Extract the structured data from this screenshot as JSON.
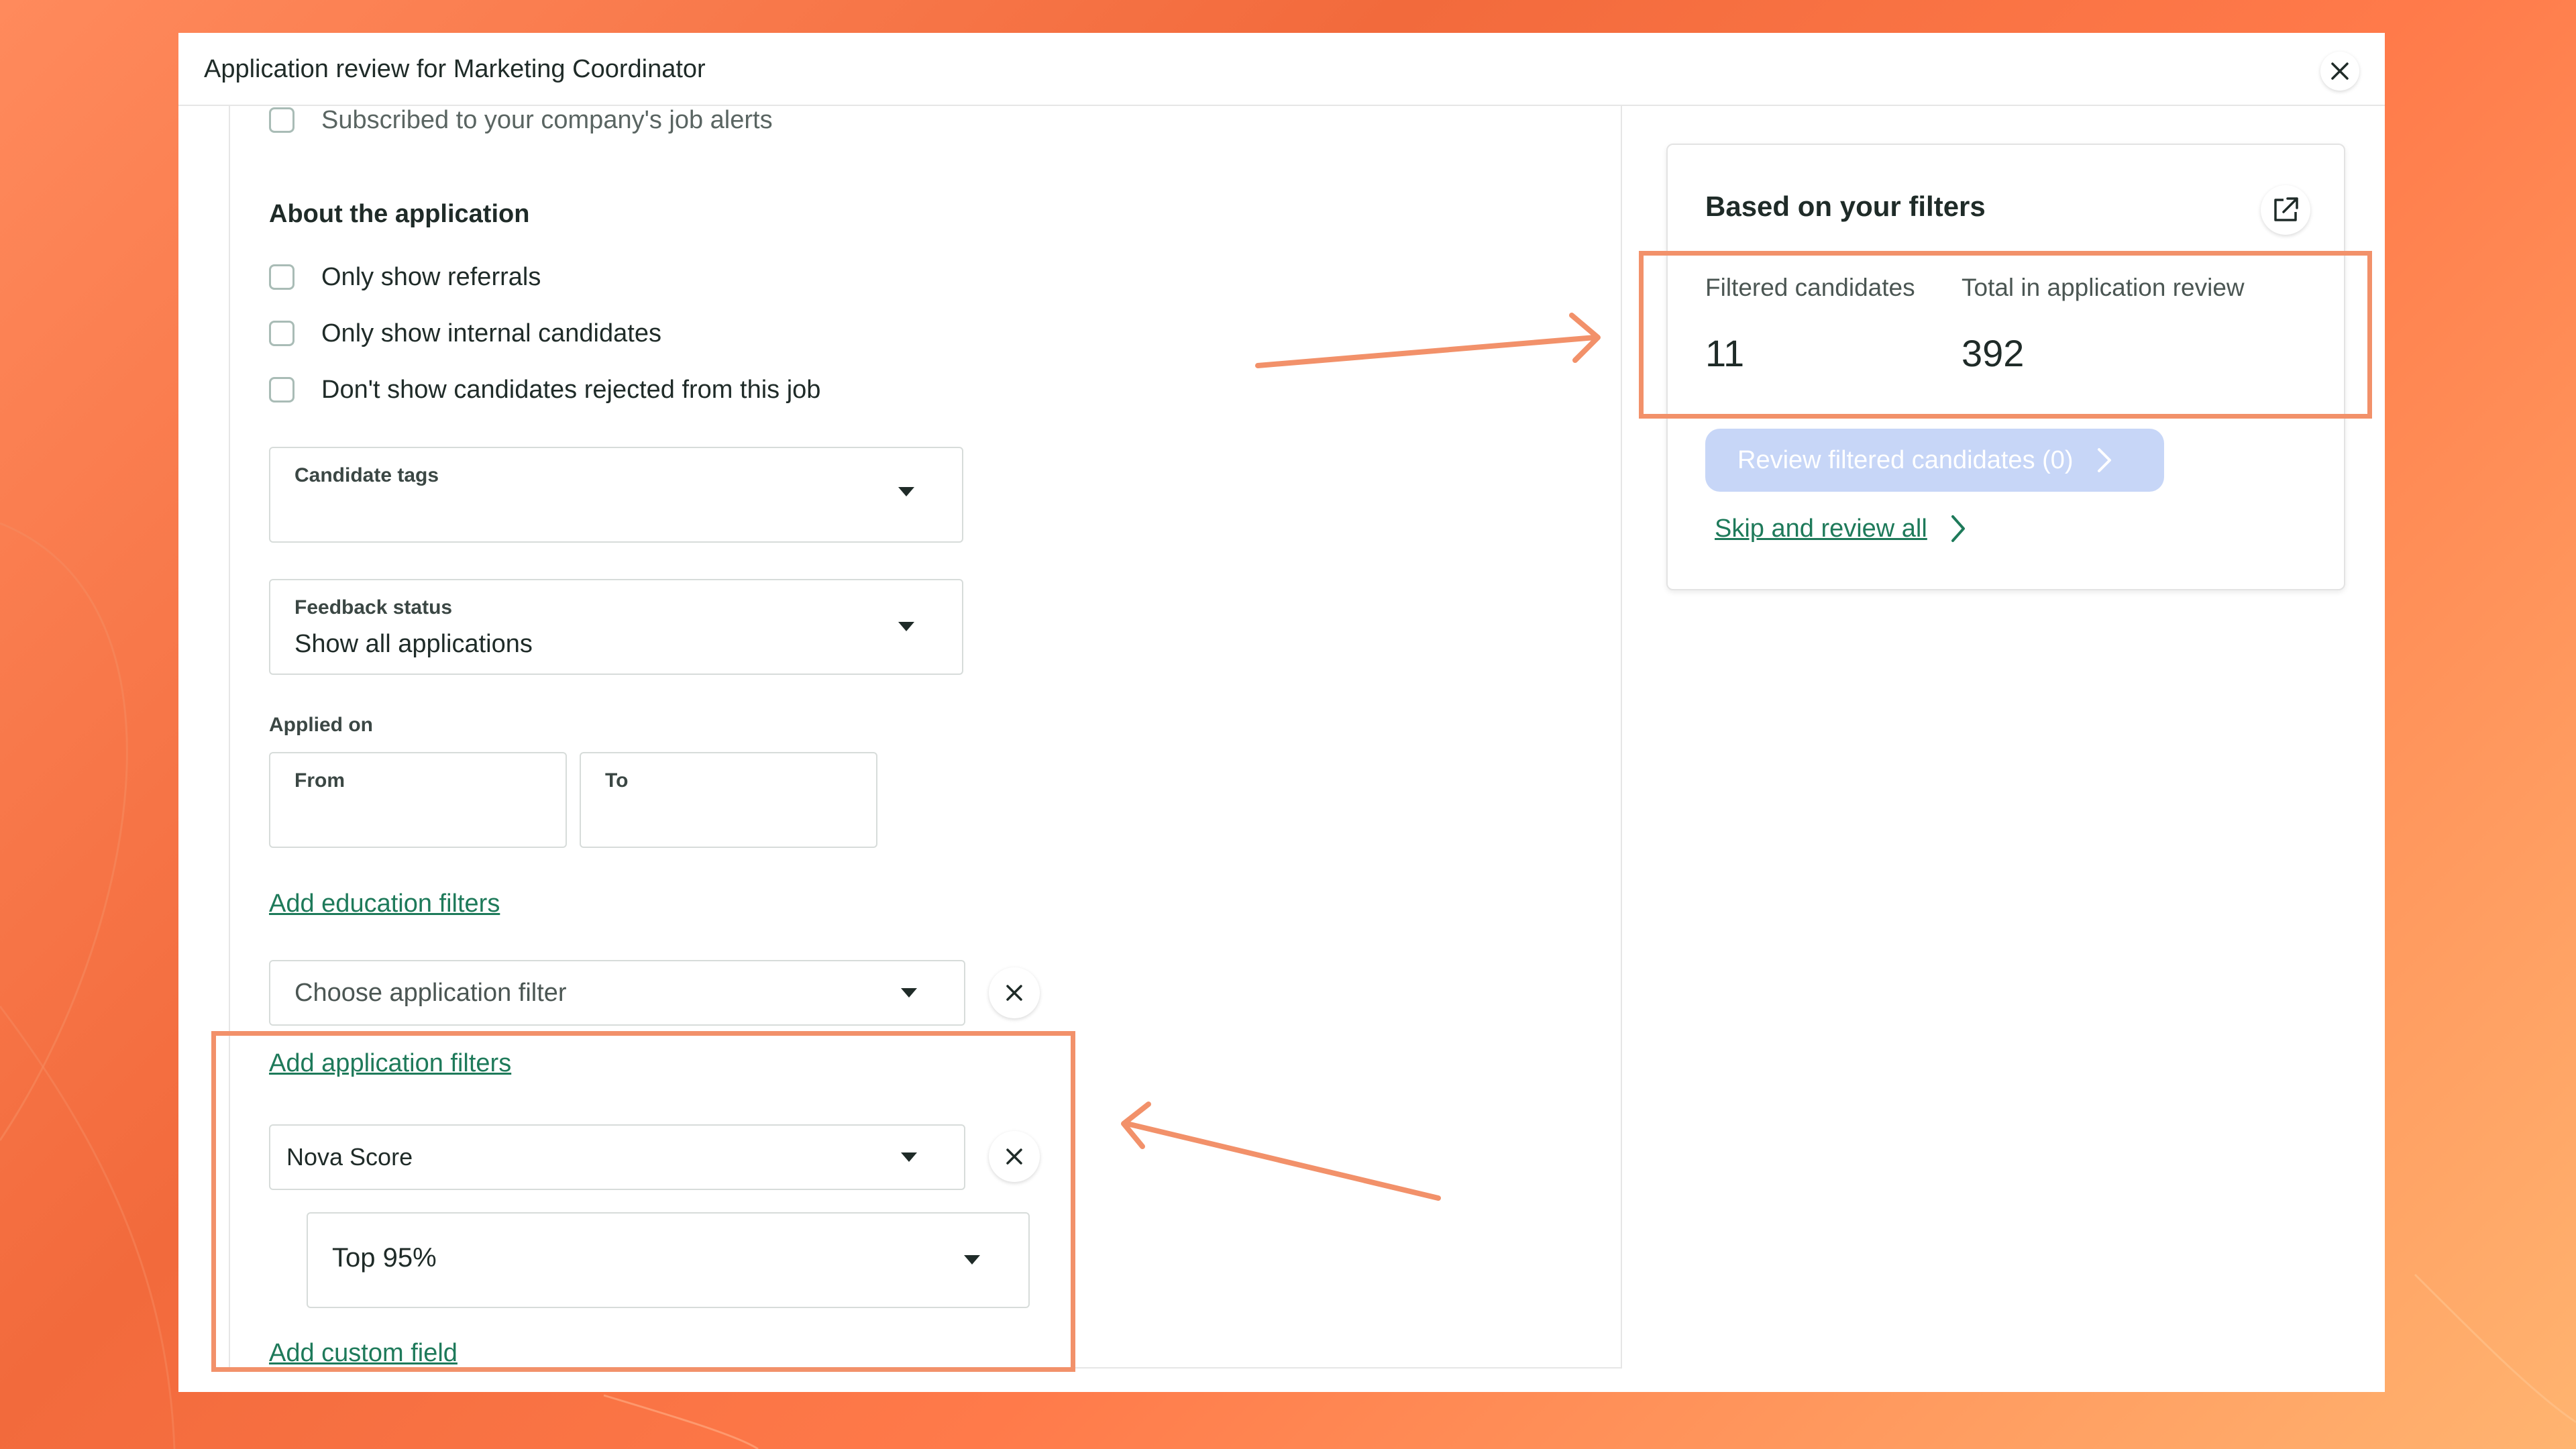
{
  "background": {
    "accent": "#f26a3c"
  },
  "modal": {
    "title": "Application review for Marketing Coordinator",
    "close_icon": "close-icon"
  },
  "filters": {
    "partial_checkbox_label": "Subscribed to your company's job alerts",
    "about_heading": "About the application",
    "checkboxes": [
      {
        "label": "Only show referrals",
        "checked": false
      },
      {
        "label": "Only show internal candidates",
        "checked": false
      },
      {
        "label": "Don't show candidates rejected from this job",
        "checked": false
      }
    ],
    "candidate_tags": {
      "caption": "Candidate tags",
      "value": ""
    },
    "feedback_status": {
      "caption": "Feedback status",
      "value": "Show all applications"
    },
    "applied_on": {
      "label": "Applied on",
      "from": "From",
      "to": "To"
    },
    "add_education_link": "Add education filters",
    "application_filter": {
      "placeholder": "Choose application filter"
    },
    "add_application_link": "Add application filters",
    "nova_filter": {
      "value": "Nova Score"
    },
    "nova_threshold": {
      "value": "Top 95%"
    },
    "add_custom_link": "Add custom field"
  },
  "summary": {
    "title": "Based on your filters",
    "filtered_label": "Filtered candidates",
    "filtered_value": "11",
    "total_label": "Total in application review",
    "total_value": "392",
    "review_button": "Review filtered candidates (0)",
    "skip_link": "Skip and review all",
    "review_button_color": "#c7d6f7",
    "link_color": "#1e7a5a"
  },
  "annotations": {
    "color": "#f2916a"
  }
}
